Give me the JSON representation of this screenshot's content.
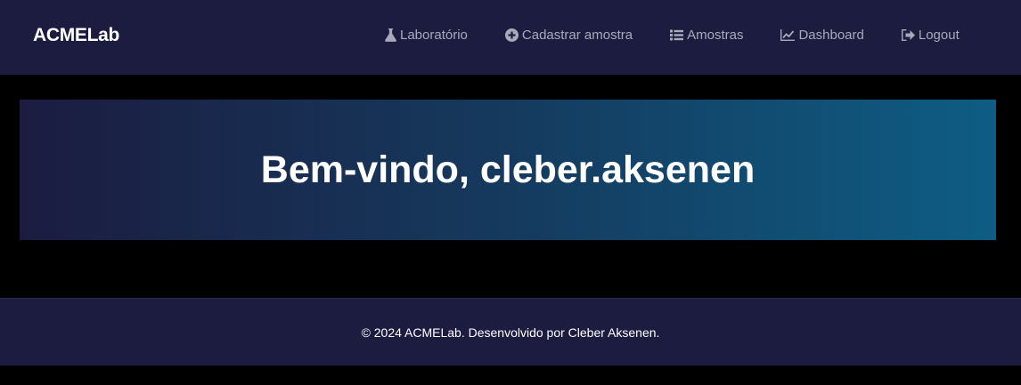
{
  "navbar": {
    "brand": "ACMELab",
    "items": [
      {
        "label": "Laboratório",
        "icon": "flask-icon"
      },
      {
        "label": "Cadastrar amostra",
        "icon": "plus-circle-icon"
      },
      {
        "label": "Amostras",
        "icon": "list-icon"
      },
      {
        "label": "Dashboard",
        "icon": "chart-line-icon"
      },
      {
        "label": "Logout",
        "icon": "sign-out-icon"
      }
    ]
  },
  "hero": {
    "title": "Bem-vindo, cleber.aksenen"
  },
  "footer": {
    "text": "© 2024 ACMELab. Desenvolvido por Cleber Aksenen."
  },
  "colors": {
    "navbar_bg": "#1b1c40",
    "page_bg": "#000000",
    "hero_gradient_start": "#1b1c40",
    "hero_gradient_end": "#0e5d84",
    "nav_link": "#a9aab9"
  }
}
